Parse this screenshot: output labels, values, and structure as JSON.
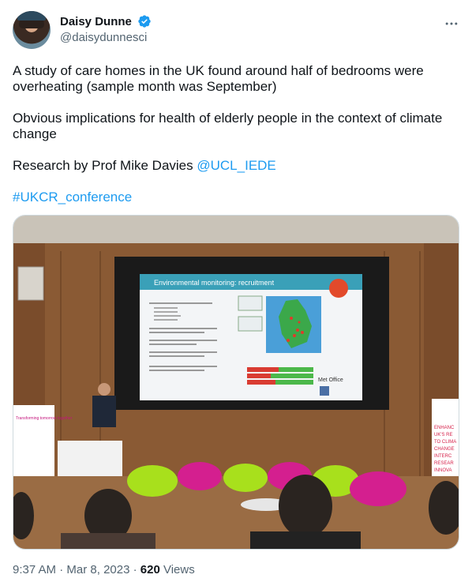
{
  "author": {
    "display_name": "Daisy Dunne",
    "handle": "@daisydunnesci",
    "verified": true,
    "verified_color": "#1d9bf0"
  },
  "more_icon": "more-horizontal-icon",
  "tweet": {
    "line1": "A study of care homes in the UK found around half of bedrooms were overheating (sample month was September)",
    "line2": "Obvious implications for health of elderly people in the context of climate change",
    "line3_prefix": "Research by Prof Mike Davies ",
    "mention": "@UCL_IEDE",
    "hashtag": "#UKCR_conference"
  },
  "photo": {
    "slide_title": "Environmental monitoring: recruitment",
    "slide_bullets": [
      "Currently engaged with 47 care homes:",
      "Almost half of the 590 bedrooms monitored were found to be overheated.",
      "Criterion A (dynamic threshold temperature) failed in 20% of bedrooms.",
      "Criterion B (26 °C threshold temperature - night time hours) failed in 20% of bedrooms.",
      "Criterion C (26 °C threshold temperature - all occupied hours) failed in 63% of bedrooms."
    ],
    "slide_logo_met": "Met Office",
    "banner_left": "Transforming tomorrow together",
    "banner_right": "ENHANC UK'S RE TO CLIMA CHANGE INTERC RESEAR INNOVA"
  },
  "meta": {
    "time": "9:37 AM",
    "sep1": " · ",
    "date": "Mar 8, 2023",
    "sep2": " · ",
    "views_count": "620",
    "views_label": " Views"
  },
  "colors": {
    "link": "#1d9bf0",
    "secondary_text": "#536471",
    "primary_text": "#0f1419"
  }
}
